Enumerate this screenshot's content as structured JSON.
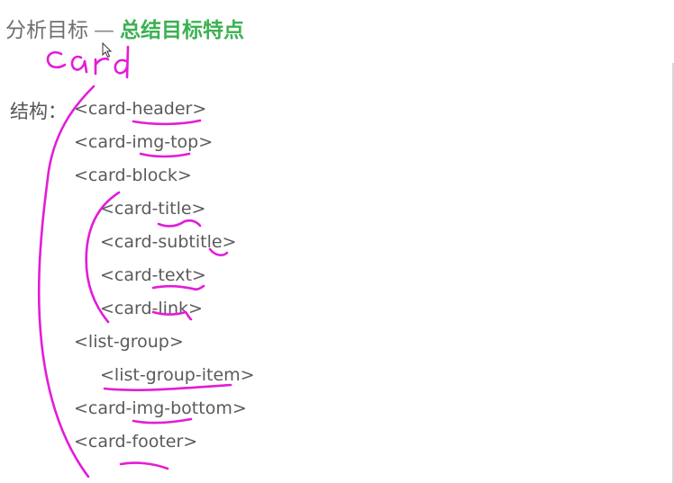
{
  "header": {
    "prefix": "分析目标",
    "separator": "—",
    "highlight": "总结目标特点"
  },
  "annotation": {
    "handwritten_word": "card"
  },
  "structure": {
    "label": "结构：",
    "items": [
      "<card-header>",
      "<card-img-top>",
      "<card-block>",
      "<card-title>",
      "<card-subtitle>",
      "<card-text>",
      "<card-link>",
      "<list-group>",
      "<list-group-item>",
      "<card-img-bottom>",
      "<card-footer>"
    ]
  },
  "colors": {
    "highlight": "#3bb152",
    "ink": "#e31cd8",
    "text": "#5a5a5a"
  }
}
